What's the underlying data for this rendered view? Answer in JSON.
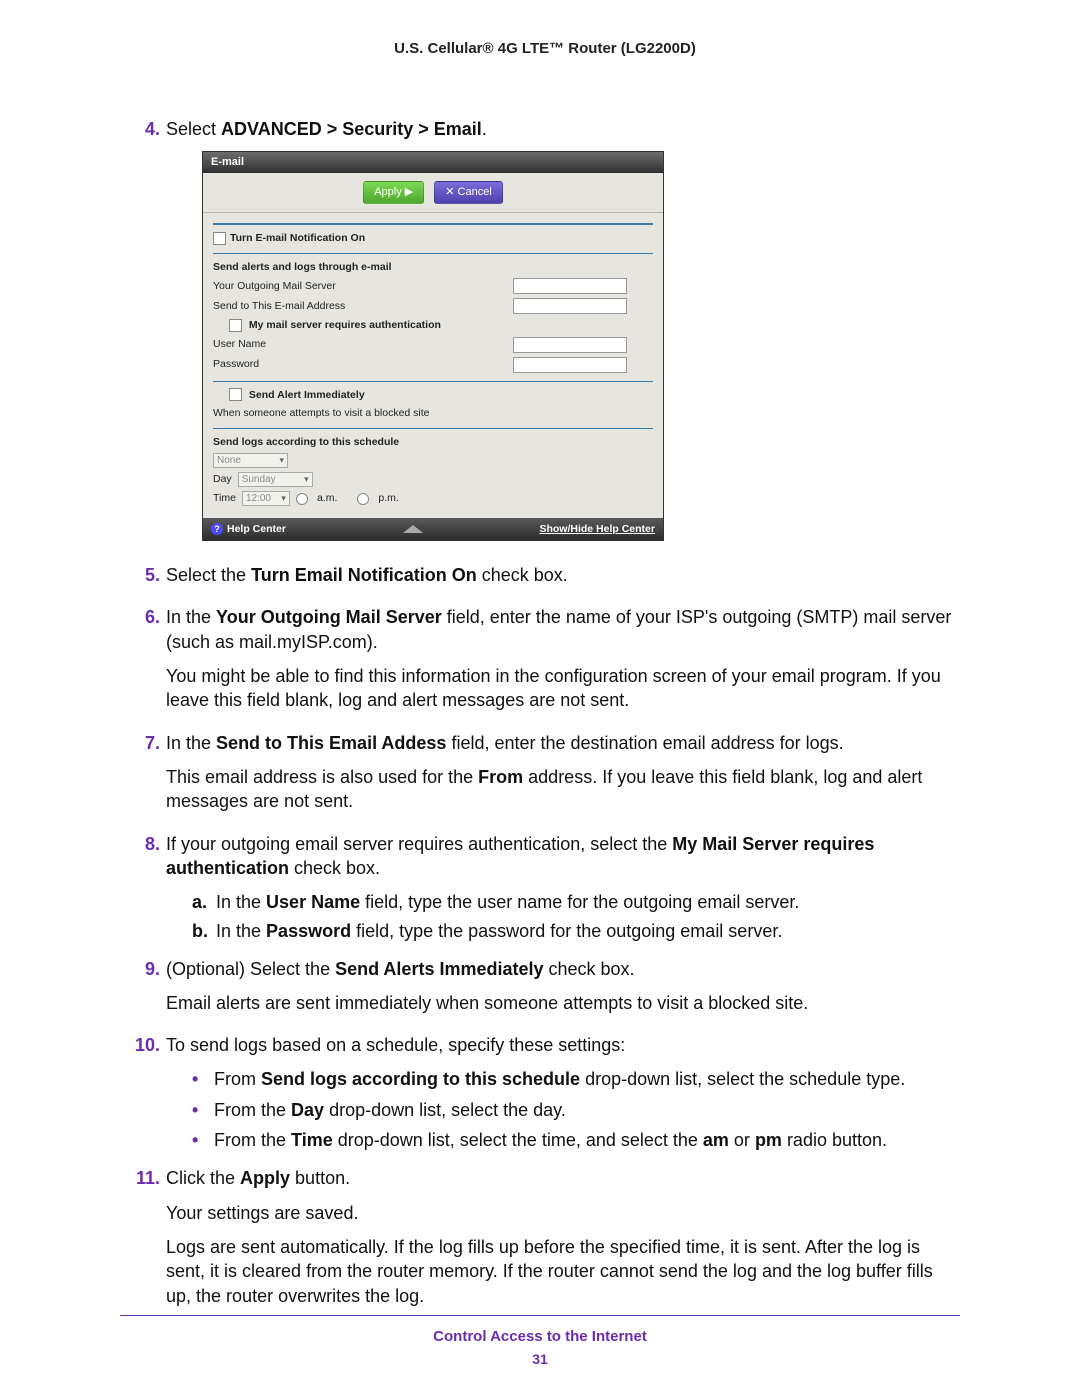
{
  "doc_header": "U.S. Cellular® 4G LTE™ Router (LG2200D)",
  "steps": {
    "s4_num": "4.",
    "s4_pre": "Select ",
    "s4_bold": "ADVANCED > Security > Email",
    "s4_post": ".",
    "s5_num": "5.",
    "s5_pre": "Select the ",
    "s5_bold": "Turn Email Notification On",
    "s5_post": " check box.",
    "s6_num": "6.",
    "s6_pre": "In the ",
    "s6_bold": "Your Outgoing Mail Server",
    "s6_post": " field, enter the name of your ISP's outgoing (SMTP) mail server (such as mail.myISP.com).",
    "s6_para2": "You might be able to find this information in the configuration screen of your email program. If you leave this field blank, log and alert messages are not sent.",
    "s7_num": "7.",
    "s7_pre": "In the ",
    "s7_bold": "Send to This Email Addess",
    "s7_post": " field, enter the destination email address for logs.",
    "s7_para2_pre": "This email address is also used for the ",
    "s7_para2_bold": "From",
    "s7_para2_post": " address. If you leave this field blank, log and alert messages are not sent.",
    "s8_num": "8.",
    "s8_pre": "If your outgoing email server requires authentication, select the ",
    "s8_bold": "My Mail Server requires authentication",
    "s8_post": " check box.",
    "s8a_num": "a.",
    "s8a_pre": "In the ",
    "s8a_bold": "User Name",
    "s8a_post": " field, type the user name for the outgoing email server.",
    "s8b_num": "b.",
    "s8b_pre": "In the ",
    "s8b_bold": "Password",
    "s8b_post": " field, type the password for the outgoing email server.",
    "s9_num": "9.",
    "s9_pre": "(Optional) Select the ",
    "s9_bold": "Send Alerts Immediately",
    "s9_post": " check box.",
    "s9_para2": "Email alerts are sent immediately when someone attempts to visit a blocked site.",
    "s10_num": "10.",
    "s10_text": "To send logs based on a schedule, specify these settings:",
    "s10_b1_pre": "From ",
    "s10_b1_bold": "Send logs according to this schedule",
    "s10_b1_post": " drop-down list, select the schedule type.",
    "s10_b2_pre": "From the ",
    "s10_b2_bold": "Day",
    "s10_b2_post": " drop-down list, select the day.",
    "s10_b3_pre": "From the ",
    "s10_b3_bold": "Time",
    "s10_b3_post_a": " drop-down list, select the time, and select the ",
    "s10_b3_bold_am": "am",
    "s10_b3_mid": " or ",
    "s10_b3_bold_pm": "pm",
    "s10_b3_post_b": " radio button.",
    "s11_num": "11.",
    "s11_pre": "Click the ",
    "s11_bold": "Apply",
    "s11_post": " button.",
    "s11_para2": "Your settings are saved.",
    "s11_para3": "Logs are sent automatically. If the log fills up before the specified time, it is sent. After the log is sent, it is cleared from the router memory. If the router cannot send the log and the log buffer fills up, the router overwrites the log."
  },
  "shot": {
    "title": "E-mail",
    "apply_btn": "Apply ▶",
    "cancel_btn": "✕ Cancel",
    "turn_on": "Turn E-mail Notification On",
    "send_alerts_heading": "Send alerts and logs through e-mail",
    "outgoing_server": "Your Outgoing Mail Server",
    "send_to": "Send to This E-mail Address",
    "requires_auth": "My mail server requires authentication",
    "user_name": "User Name",
    "password": "Password",
    "send_alert_immediately": "Send Alert Immediately",
    "when_attempts": "When someone attempts to visit a blocked site",
    "schedule_heading": "Send logs according to this schedule",
    "schedule_value": "None",
    "day_label": "Day",
    "day_value": "Sunday",
    "time_label": "Time",
    "time_value": "12:00",
    "am_label": "a.m.",
    "pm_label": "p.m.",
    "help_center": "Help Center",
    "show_hide": "Show/Hide Help Center",
    "help_q": "?"
  },
  "footer": {
    "title": "Control Access to the Internet",
    "page": "31"
  }
}
